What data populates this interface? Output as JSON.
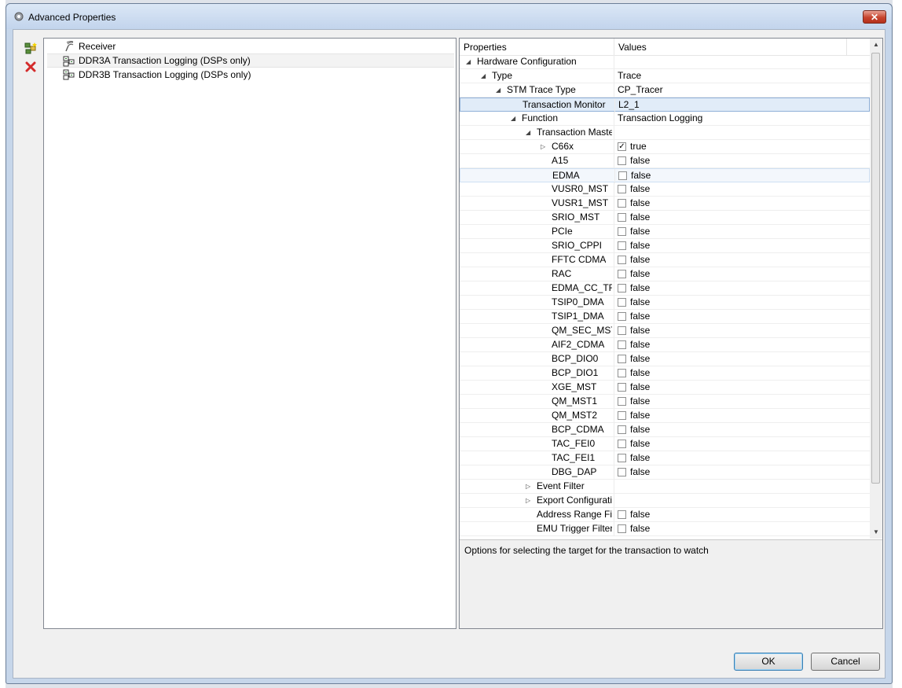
{
  "window": {
    "title": "Advanced Properties",
    "close_label": "✕"
  },
  "toolbar": {
    "add_icon": "add-config-icon",
    "delete_icon": "delete-icon"
  },
  "tree": {
    "items": [
      {
        "label": "Receiver",
        "icon": "receiver-icon"
      },
      {
        "label": "DDR3A Transaction Logging (DSPs only)",
        "icon": "config-icon",
        "selected": true
      },
      {
        "label": "DDR3B Transaction Logging (DSPs only)",
        "icon": "config-icon"
      }
    ]
  },
  "properties": {
    "col_properties": "Properties",
    "col_values": "Values",
    "rows": [
      {
        "name": "Hardware Configuration",
        "value": "",
        "level": 0,
        "arrow": "expanded"
      },
      {
        "name": "Type",
        "value": "Trace",
        "level": 1,
        "arrow": "expanded"
      },
      {
        "name": "STM Trace Type",
        "value": "CP_Tracer",
        "level": 2,
        "arrow": "expanded"
      },
      {
        "name": "Transaction Monitor",
        "value": "L2_1",
        "level": 3,
        "arrow": "none",
        "state": "selected"
      },
      {
        "name": "Function",
        "value": "Transaction Logging",
        "level": 3,
        "arrow": "expanded"
      },
      {
        "name": "Transaction Maste",
        "value": "",
        "level": 4,
        "arrow": "expanded"
      },
      {
        "name": "C66x",
        "value": "true",
        "level": 5,
        "arrow": "collapsed",
        "checkbox": true,
        "checked": true
      },
      {
        "name": "A15",
        "value": "false",
        "level": 5,
        "arrow": "none",
        "checkbox": true
      },
      {
        "name": "EDMA",
        "value": "false",
        "level": 5,
        "arrow": "none",
        "checkbox": true,
        "state": "hover"
      },
      {
        "name": "VUSR0_MST",
        "value": "false",
        "level": 5,
        "arrow": "none",
        "checkbox": true
      },
      {
        "name": "VUSR1_MST",
        "value": "false",
        "level": 5,
        "arrow": "none",
        "checkbox": true
      },
      {
        "name": "SRIO_MST",
        "value": "false",
        "level": 5,
        "arrow": "none",
        "checkbox": true
      },
      {
        "name": "PCIe",
        "value": "false",
        "level": 5,
        "arrow": "none",
        "checkbox": true
      },
      {
        "name": "SRIO_CPPI",
        "value": "false",
        "level": 5,
        "arrow": "none",
        "checkbox": true
      },
      {
        "name": "FFTC CDMA",
        "value": "false",
        "level": 5,
        "arrow": "none",
        "checkbox": true
      },
      {
        "name": "RAC",
        "value": "false",
        "level": 5,
        "arrow": "none",
        "checkbox": true
      },
      {
        "name": "EDMA_CC_TR",
        "value": "false",
        "level": 5,
        "arrow": "none",
        "checkbox": true
      },
      {
        "name": "TSIP0_DMA",
        "value": "false",
        "level": 5,
        "arrow": "none",
        "checkbox": true
      },
      {
        "name": "TSIP1_DMA",
        "value": "false",
        "level": 5,
        "arrow": "none",
        "checkbox": true
      },
      {
        "name": "QM_SEC_MST",
        "value": "false",
        "level": 5,
        "arrow": "none",
        "checkbox": true
      },
      {
        "name": "AIF2_CDMA",
        "value": "false",
        "level": 5,
        "arrow": "none",
        "checkbox": true
      },
      {
        "name": "BCP_DIO0",
        "value": "false",
        "level": 5,
        "arrow": "none",
        "checkbox": true
      },
      {
        "name": "BCP_DIO1",
        "value": "false",
        "level": 5,
        "arrow": "none",
        "checkbox": true
      },
      {
        "name": "XGE_MST",
        "value": "false",
        "level": 5,
        "arrow": "none",
        "checkbox": true
      },
      {
        "name": "QM_MST1",
        "value": "false",
        "level": 5,
        "arrow": "none",
        "checkbox": true
      },
      {
        "name": "QM_MST2",
        "value": "false",
        "level": 5,
        "arrow": "none",
        "checkbox": true
      },
      {
        "name": "BCP_CDMA",
        "value": "false",
        "level": 5,
        "arrow": "none",
        "checkbox": true
      },
      {
        "name": "TAC_FEI0",
        "value": "false",
        "level": 5,
        "arrow": "none",
        "checkbox": true
      },
      {
        "name": "TAC_FEI1",
        "value": "false",
        "level": 5,
        "arrow": "none",
        "checkbox": true
      },
      {
        "name": "DBG_DAP",
        "value": "false",
        "level": 5,
        "arrow": "none",
        "checkbox": true
      },
      {
        "name": "Event Filter",
        "value": "",
        "level": 4,
        "arrow": "collapsed"
      },
      {
        "name": "Export Configurati",
        "value": "",
        "level": 4,
        "arrow": "collapsed"
      },
      {
        "name": "Address Range Filt",
        "value": "false",
        "level": 4,
        "arrow": "none",
        "checkbox": true
      },
      {
        "name": "EMU Trigger Filter",
        "value": "false",
        "level": 4,
        "arrow": "none",
        "checkbox": true
      }
    ],
    "description": "Options for selecting the target for the transaction to watch"
  },
  "buttons": {
    "ok": "OK",
    "cancel": "Cancel"
  },
  "colors": {
    "selected_row": "#e1ecf8",
    "title_gradient_top": "#dbe7f6",
    "close_red": "#c7442e"
  }
}
